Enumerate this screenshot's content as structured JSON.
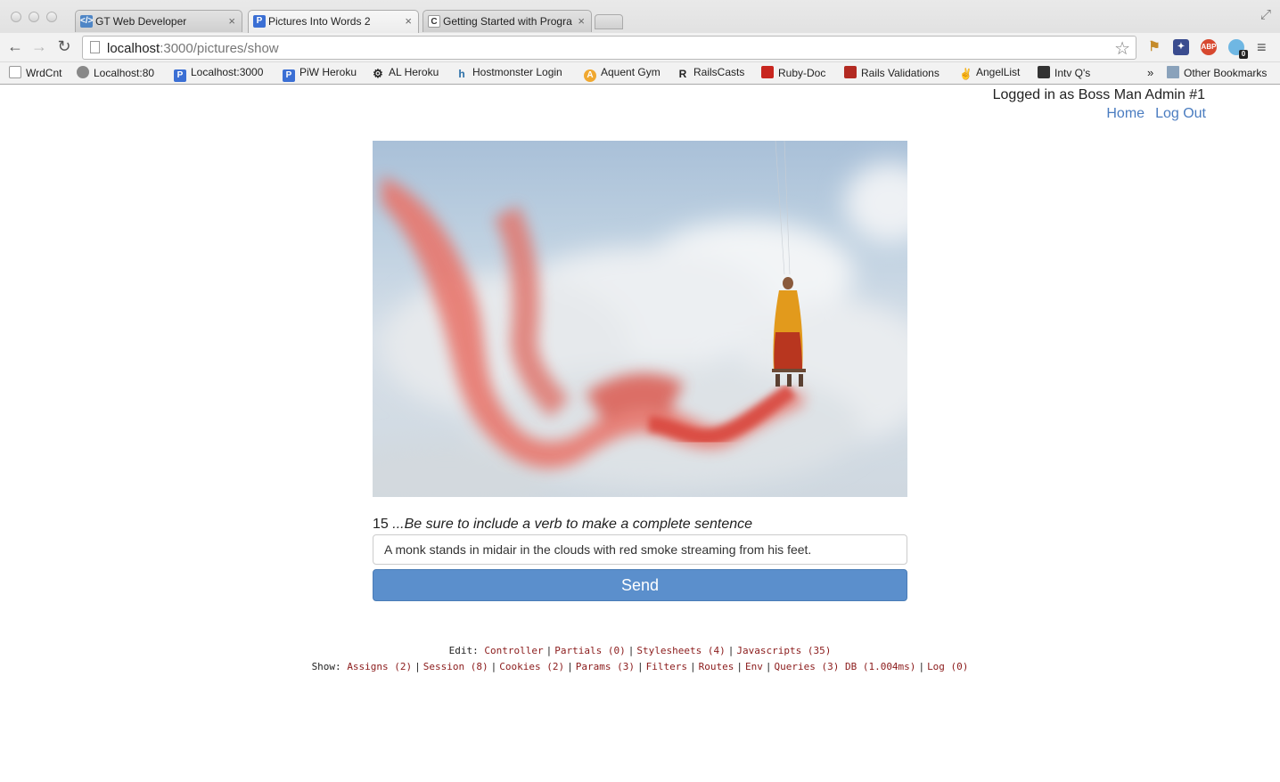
{
  "browser": {
    "tabs": [
      {
        "title": "GT Web Developer",
        "active": false
      },
      {
        "title": "Pictures Into Words 2",
        "active": true
      },
      {
        "title": "Getting Started with Progra",
        "active": false
      }
    ],
    "url": {
      "host": "localhost",
      "rest": ":3000/pictures/show"
    },
    "bookmarks": [
      {
        "label": "WrdCnt",
        "icon": "page-icon"
      },
      {
        "label": "Localhost:80",
        "icon": "globe-icon"
      },
      {
        "label": "Localhost:3000",
        "icon": "p-icon"
      },
      {
        "label": "PiW Heroku",
        "icon": "p-icon"
      },
      {
        "label": "AL Heroku",
        "icon": "gear-icon"
      },
      {
        "label": "Hostmonster Login",
        "icon": "hostmonster-icon"
      },
      {
        "label": "Aquent Gym",
        "icon": "aquent-icon"
      },
      {
        "label": "RailsCasts",
        "icon": "railscasts-icon"
      },
      {
        "label": "Ruby-Doc",
        "icon": "ruby-icon"
      },
      {
        "label": "Rails Validations",
        "icon": "ruby-icon"
      },
      {
        "label": "AngelList",
        "icon": "peace-icon"
      },
      {
        "label": "Intv Q's",
        "icon": "intv-icon"
      }
    ],
    "overflow": "»",
    "other_bookmarks": "Other Bookmarks",
    "extension_badge": "0"
  },
  "header": {
    "login_text": "Logged in as Boss Man Admin #1",
    "home_link": "Home",
    "logout_link": "Log Out"
  },
  "form": {
    "count": "15",
    "hint": "...Be sure to include a verb to make a complete sentence",
    "answer_value": "A monk stands in midair in the clouds with red smoke streaming from his feet.",
    "send_label": "Send"
  },
  "debug_footer": {
    "edit_label": "Edit:",
    "edit_links": [
      "Controller",
      "Partials (0)",
      "Stylesheets (4)",
      "Javascripts (35)"
    ],
    "show_label": "Show:",
    "show_links": [
      "Assigns (2)",
      "Session (8)",
      "Cookies (2)",
      "Params (3)",
      "Filters",
      "Routes",
      "Env",
      "Queries (3) DB (1.004ms)",
      "Log (0)"
    ]
  },
  "colors": {
    "link_blue": "#4a7cc0",
    "button_blue": "#5b8fcc",
    "debug_link_red": "#8b1b1b"
  }
}
